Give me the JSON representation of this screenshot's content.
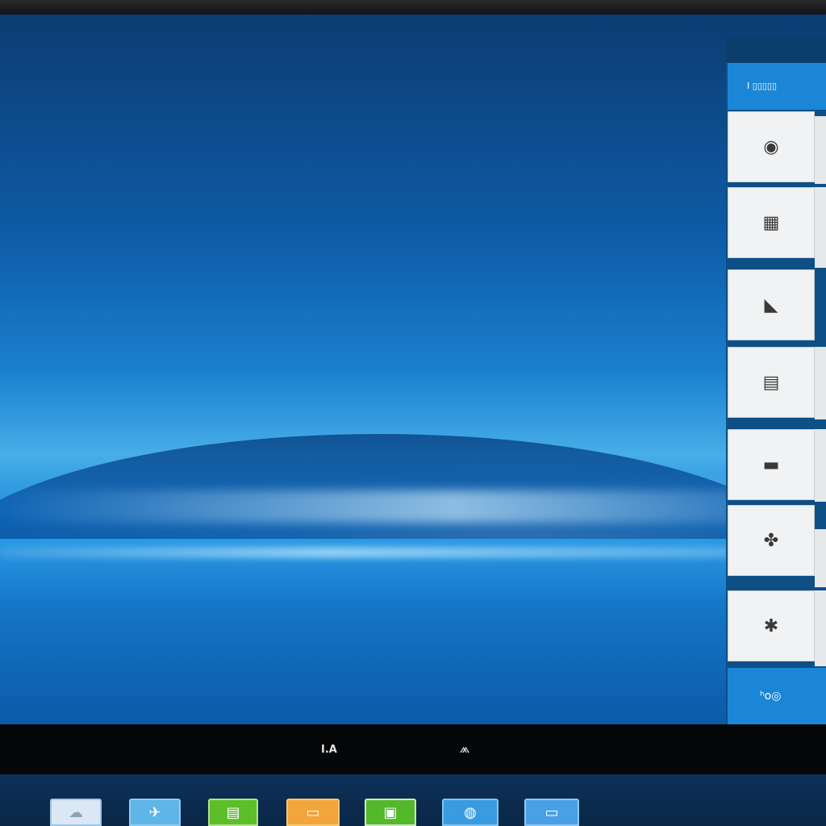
{
  "window": {
    "panel_header": "I ▯▯▯▯▯"
  },
  "side_panel": {
    "tiles": [
      {
        "name": "tile-settings",
        "icon": "camera-icon",
        "glyph": "◉"
      },
      {
        "name": "tile-calendar",
        "icon": "calendar-icon",
        "glyph": "▦"
      },
      {
        "name": "tile-mail",
        "icon": "mail-icon",
        "glyph": "◣"
      },
      {
        "name": "tile-document",
        "icon": "document-icon",
        "glyph": "▤"
      },
      {
        "name": "tile-photos",
        "icon": "photo-icon",
        "glyph": "▬"
      },
      {
        "name": "tile-app-a",
        "icon": "app-icon",
        "glyph": "✤"
      },
      {
        "name": "tile-app-b",
        "icon": "puzzle-icon",
        "glyph": "✱"
      }
    ],
    "footer_label": "ʰo◎"
  },
  "bar": {
    "text": "I.A",
    "icon_glyph": "⩕"
  },
  "taskbar": {
    "icons": [
      {
        "name": "taskbar-cloud",
        "icon": "cloud-icon",
        "glyph": "☁",
        "color": "#dbe8f3"
      },
      {
        "name": "taskbar-twitter",
        "icon": "bird-icon",
        "glyph": "✈",
        "color": "#5fb4e8"
      },
      {
        "name": "taskbar-green",
        "icon": "spreadsheet-icon",
        "glyph": "▤",
        "color": "#5cbf2a"
      },
      {
        "name": "taskbar-orange",
        "icon": "folder-icon",
        "glyph": "▭",
        "color": "#f2a53a"
      },
      {
        "name": "taskbar-files",
        "icon": "image-icon",
        "glyph": "▣",
        "color": "#54b82b"
      },
      {
        "name": "taskbar-globe",
        "icon": "globe-icon",
        "glyph": "◍",
        "color": "#3a9be0"
      },
      {
        "name": "taskbar-window",
        "icon": "window-icon",
        "glyph": "▭",
        "color": "#4aa0e6"
      }
    ]
  }
}
